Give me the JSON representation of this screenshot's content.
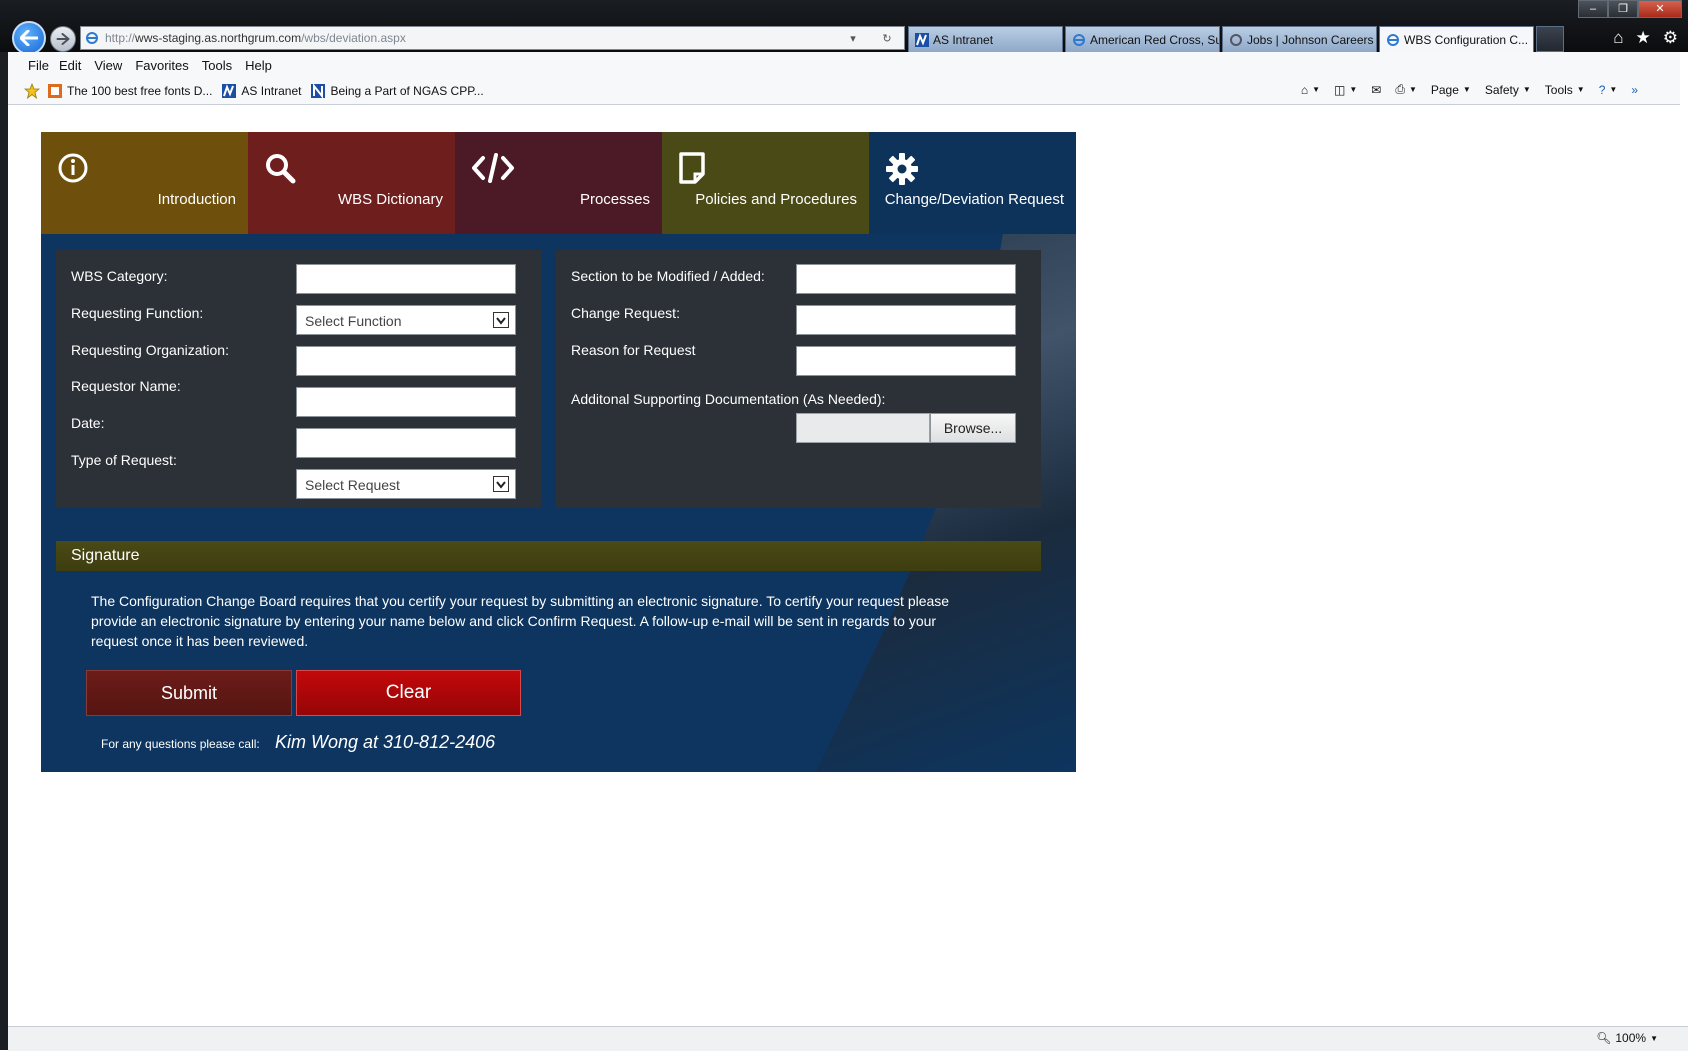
{
  "browser": {
    "address": {
      "url_scheme": "http://",
      "url_host": "wws-staging.as.northgrum.com",
      "url_path": "/wbs/deviation.aspx"
    },
    "tabs": [
      {
        "label": "AS Intranet"
      },
      {
        "label": "American Red Cross, Su..."
      },
      {
        "label": "Jobs | Johnson Careers"
      },
      {
        "label": "WBS Configuration C...",
        "close": "✕"
      }
    ],
    "menu": [
      "File",
      "Edit",
      "View",
      "Favorites",
      "Tools",
      "Help"
    ],
    "favorites": [
      {
        "label": "The 100 best free fonts  D..."
      },
      {
        "label": "AS Intranet"
      },
      {
        "label": "Being a Part of NGAS CPP..."
      }
    ],
    "commands": {
      "page": "Page",
      "safety": "Safety",
      "tools": "Tools",
      "chevron": "»"
    },
    "zoom": "100%"
  },
  "nav": [
    {
      "label": "Introduction",
      "icon": "info-icon"
    },
    {
      "label": "WBS Dictionary",
      "icon": "search-icon"
    },
    {
      "label": "Processes",
      "icon": "code-icon"
    },
    {
      "label": "Policies and Procedures",
      "icon": "document-icon"
    },
    {
      "label": "Change/Deviation Request",
      "icon": "gear-icon"
    }
  ],
  "form": {
    "left": {
      "wbs_category": "WBS Category:",
      "requesting_function": "Requesting Function:",
      "requesting_function_value": "Select Function",
      "requesting_organization": "Requesting Organization:",
      "requestor_name": "Requestor Name:",
      "date": "Date:",
      "type_of_request": "Type of Request:",
      "type_of_request_value": "Select Request"
    },
    "right": {
      "section_modified": "Section to be Modified / Added:",
      "change_request": "Change Request:",
      "reason": "Reason for Request",
      "supporting_docs": "Additonal Supporting Documentation (As Needed):",
      "browse": "Browse..."
    }
  },
  "signature": {
    "heading": "Signature",
    "text": "The Configuration Change Board requires that you certify your request by submitting an electronic signature. To certify your request please provide an electronic signature by entering your name below and click Confirm Request. A follow-up e-mail will be sent in regards to your request once it has been reviewed.",
    "submit": "Submit",
    "clear": "Clear",
    "contact_label": "For any questions please call:",
    "contact_value": "Kim Wong at 310-812-2406"
  }
}
